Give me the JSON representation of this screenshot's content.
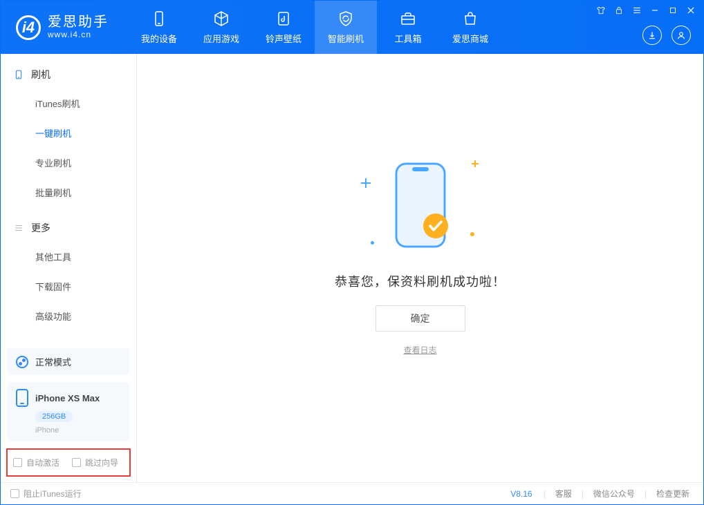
{
  "app": {
    "name_cn": "爱思助手",
    "name_en": "www.i4.cn"
  },
  "tabs": [
    {
      "label": "我的设备"
    },
    {
      "label": "应用游戏"
    },
    {
      "label": "铃声壁纸"
    },
    {
      "label": "智能刷机"
    },
    {
      "label": "工具箱"
    },
    {
      "label": "爱思商城"
    }
  ],
  "sidebar": {
    "group1_title": "刷机",
    "group1_items": [
      "iTunes刷机",
      "一键刷机",
      "专业刷机",
      "批量刷机"
    ],
    "group2_title": "更多",
    "group2_items": [
      "其他工具",
      "下载固件",
      "高级功能"
    ]
  },
  "mode_label": "正常模式",
  "device": {
    "name": "iPhone XS Max",
    "storage": "256GB",
    "type": "iPhone"
  },
  "options": {
    "auto_activate": "自动激活",
    "skip_guide": "跳过向导"
  },
  "main": {
    "success_msg": "恭喜您，保资料刷机成功啦！",
    "ok": "确定",
    "view_log": "查看日志"
  },
  "footer": {
    "block_itunes": "阻止iTunes运行",
    "version": "V8.16",
    "links": [
      "客服",
      "微信公众号",
      "检查更新"
    ]
  }
}
